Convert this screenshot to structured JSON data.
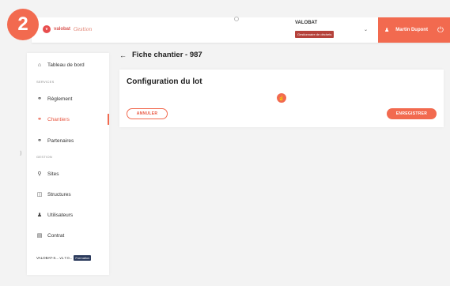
{
  "step_badge": "2",
  "topbar": {
    "logo_text": "valobat",
    "logo_script": "Gestion",
    "company_name": "VALOBAT",
    "company_role": "Gestionnaire de déchets",
    "user_name": "Martin Dupont",
    "icons": {
      "chevron": "chevron-down-icon",
      "user": "user-icon",
      "power": "power-icon"
    }
  },
  "sidebar": {
    "dashboard": "Tableau de bord",
    "section_services": "SERVICES",
    "reglement": "Règlement",
    "chantiers": "Chantiers",
    "partenaires": "Partenaires",
    "section_gestion": "GESTION",
    "sites": "Sites",
    "structures": "Structures",
    "utilisateurs": "Utilisateurs",
    "contrat": "Contrat",
    "version": "VALOBAT-S... v1.7.0...",
    "formation": "Formation"
  },
  "page": {
    "title": "Fiche chantier - 987",
    "card_title": "Configuration du lot",
    "cancel_label": "ANNULER",
    "save_label": "ENREGISTRER"
  },
  "colors": {
    "accent": "#f26a4f",
    "badge_dark": "#b5423b",
    "navy": "#2b3a5c"
  }
}
